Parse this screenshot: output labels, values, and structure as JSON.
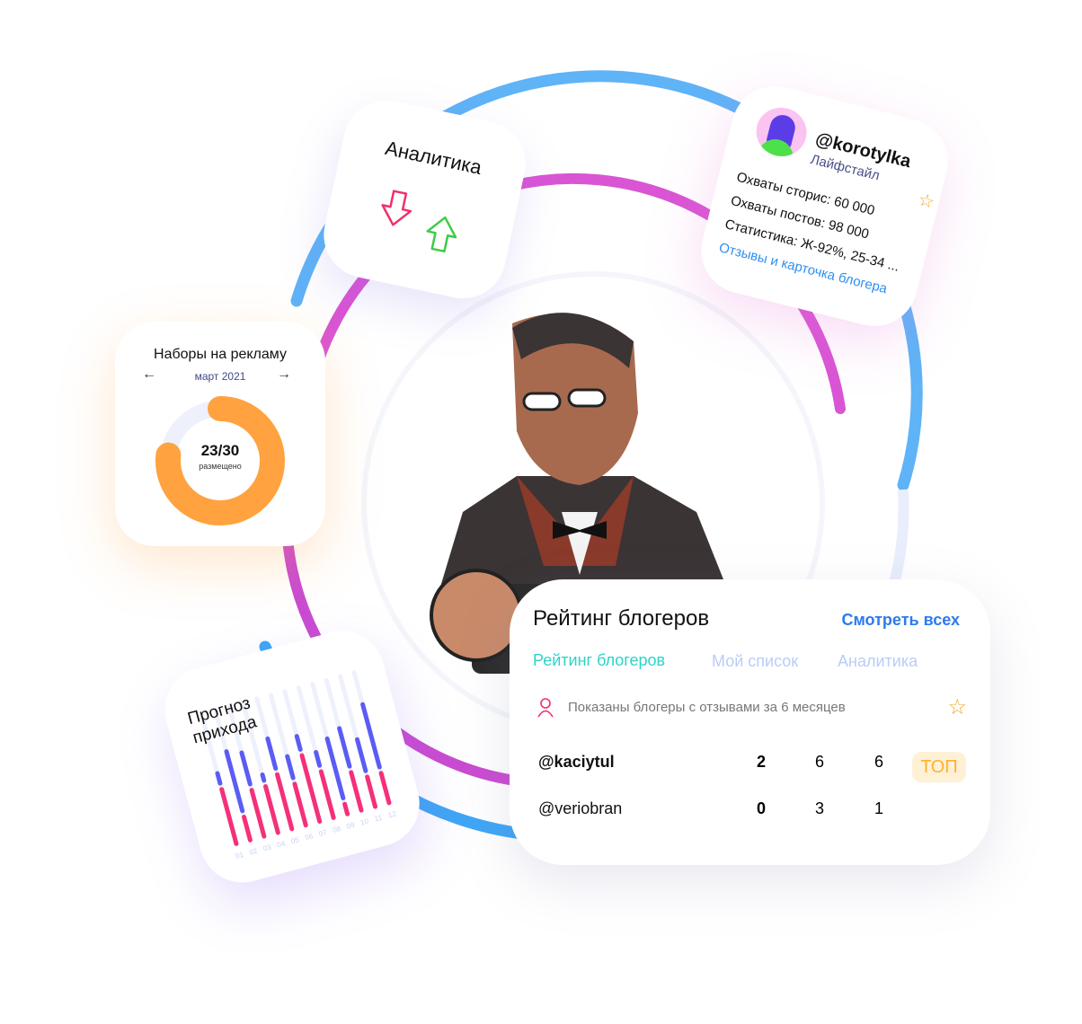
{
  "colors": {
    "blue_ring": "#4aa8f5",
    "pink_ring": "#d94fd0",
    "orange": "#ffa040",
    "teal": "#2ed3c9",
    "link_blue": "#2b7bf0",
    "star": "#f5a623"
  },
  "analytics_card": {
    "title": "Аналитика",
    "icons": [
      "arrow-down-icon",
      "arrow-up-icon"
    ]
  },
  "blogger_card": {
    "handle": "@korotylka",
    "category": "Лайфстайл",
    "stats": [
      "Охваты сторис: 60 000",
      "Охваты постов: 98 000",
      "Статистика: Ж-92%, 25-34 ..."
    ],
    "link": "Отзывы и карточка блогера",
    "icon": "star-icon"
  },
  "ads_card": {
    "title": "Наборы на рекламу",
    "month": "март 2021",
    "prev": "←",
    "next": "→",
    "value": "23/30",
    "caption": "размещено",
    "progress": 0.767
  },
  "forecast_card": {
    "title_line1": "Прогноз",
    "title_line2": "прихода"
  },
  "chart_data": {
    "type": "bar",
    "stacked": true,
    "categories": [
      "01",
      "02",
      "03",
      "04",
      "05",
      "06",
      "07",
      "08",
      "09",
      "10",
      "11",
      "12"
    ],
    "series": [
      {
        "values": [
          30,
          180,
          95,
          17,
          90,
          65,
          40,
          40,
          180,
          115,
          95,
          190
        ],
        "color": "#5b5cf5"
      },
      {
        "values": [
          165,
          70,
          140,
          140,
          165,
          125,
          200,
          140,
          30,
          115,
          90,
          90
        ],
        "color": "#f5307a"
      }
    ]
  },
  "rating_card": {
    "title": "Рейтинг блогеров",
    "see_all": "Смотреть всех",
    "tabs": [
      {
        "label": "Рейтинг блогеров",
        "active": true
      },
      {
        "label": "Мой список",
        "active": false
      },
      {
        "label": "Аналитика",
        "active": false
      }
    ],
    "notice": "Показаны блогеры с отзывами за 6 месяцев",
    "rows": [
      {
        "handle": "@kaciytul",
        "a": "2",
        "b": "6",
        "c": "6",
        "badge": "ТОП"
      },
      {
        "handle": "@veriobran",
        "a": "0",
        "b": "3",
        "c": "1",
        "badge": ""
      }
    ]
  }
}
